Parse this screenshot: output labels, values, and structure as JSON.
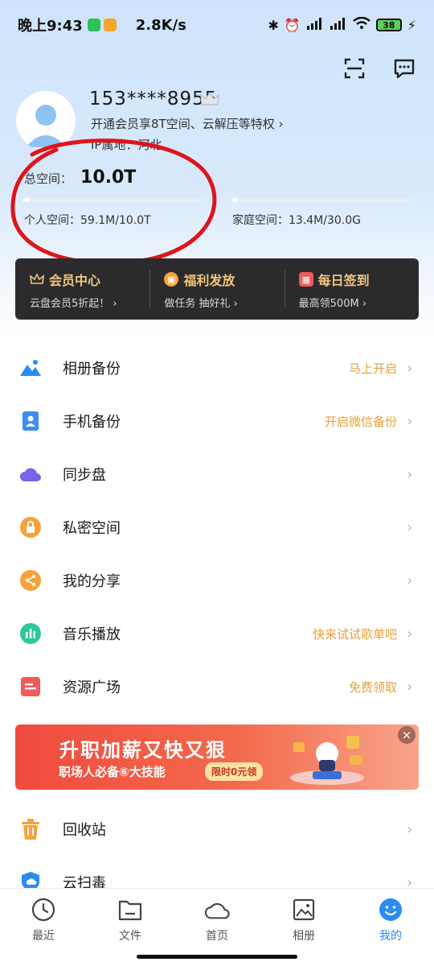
{
  "status_bar": {
    "time": "晚上9:43",
    "network_speed": "2.8K/s",
    "battery": "38"
  },
  "profile": {
    "phone": "153****8955",
    "vip_hint": "开通会员享8T空间、云解压等特权 ›",
    "ip_location": "IP属地：河北"
  },
  "storage": {
    "total_label": "总空间：",
    "total_value": "10.0T",
    "personal_label": "个人空间：59.1M/10.0T",
    "family_label": "家庭空间：13.4M/30.0G",
    "personal_fraction": 0.01,
    "family_fraction": 0.01
  },
  "vip_strip": [
    {
      "title": "会员中心",
      "sub": "云盘会员5折起！ ›",
      "icon": "crown-icon"
    },
    {
      "title": "福利发放",
      "sub": "做任务 抽好礼 ›",
      "icon": "gift-icon"
    },
    {
      "title": "每日签到",
      "sub": "最高领500M ›",
      "icon": "calendar-icon"
    }
  ],
  "menu": [
    {
      "label": "相册备份",
      "hint": "马上开启",
      "icon": "photo-mountain-icon",
      "color": "#2a8cf0"
    },
    {
      "label": "手机备份",
      "hint": "开启微信备份",
      "icon": "contact-card-icon",
      "color": "#3a8ef6"
    },
    {
      "label": "同步盘",
      "hint": "",
      "icon": "cloud-icon",
      "color": "#7a63e8"
    },
    {
      "label": "私密空间",
      "hint": "",
      "icon": "lock-icon",
      "color": "#f5a33a"
    },
    {
      "label": "我的分享",
      "hint": "",
      "icon": "share-icon",
      "color": "#f5a33a"
    },
    {
      "label": "音乐播放",
      "hint": "快来试试歌单吧",
      "icon": "music-bars-icon",
      "color": "#2fc79b"
    },
    {
      "label": "资源广场",
      "hint": "免费领取",
      "icon": "resource-icon",
      "color": "#f05a5a"
    }
  ],
  "banner": {
    "title": "升职加薪又快又狠",
    "subtitle": "职场人必备⑥大技能",
    "free_tag": "限时0元领",
    "close": "×"
  },
  "menu2": [
    {
      "label": "回收站",
      "icon": "trash-icon",
      "color": "#f5a33a"
    },
    {
      "label": "云扫毒",
      "icon": "shield-icon",
      "color": "#2a8cf0"
    }
  ],
  "bottom_nav": [
    {
      "label": "最近",
      "icon": "clock-icon"
    },
    {
      "label": "文件",
      "icon": "folder-icon"
    },
    {
      "label": "首页",
      "icon": "cloud-outline-icon"
    },
    {
      "label": "相册",
      "icon": "image-icon"
    },
    {
      "label": "我的",
      "icon": "smile-icon"
    }
  ],
  "colors": {
    "accent": "#2a8cf0",
    "hint": "#e5a23b",
    "vip_gold": "#f2c57c",
    "annotation": "#e0141b"
  }
}
